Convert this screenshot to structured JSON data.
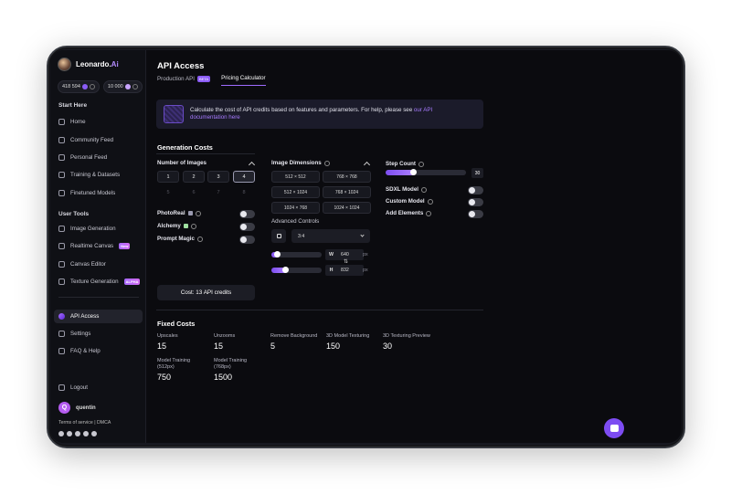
{
  "brand": {
    "name": "Leonardo.",
    "name_suffix": "Ai"
  },
  "credits": {
    "tokens": "418 594",
    "fast": "10 000"
  },
  "sidebar": {
    "start_title": "Start Here",
    "start_items": [
      {
        "label": "Home",
        "icon": "home-icon"
      },
      {
        "label": "Community Feed",
        "icon": "community-icon"
      },
      {
        "label": "Personal Feed",
        "icon": "grid-icon"
      },
      {
        "label": "Training & Datasets",
        "icon": "training-icon"
      },
      {
        "label": "Finetuned Models",
        "icon": "cube-icon"
      }
    ],
    "tools_title": "User Tools",
    "tool_items": [
      {
        "label": "Image Generation",
        "icon": "image-icon",
        "badge": ""
      },
      {
        "label": "Realtime Canvas",
        "icon": "brush-icon",
        "badge": "New"
      },
      {
        "label": "Canvas Editor",
        "icon": "canvas-icon",
        "badge": ""
      },
      {
        "label": "Texture Generation",
        "icon": "texture-icon",
        "badge": "ALPHA"
      }
    ],
    "bottom_items": [
      {
        "label": "API Access",
        "icon": "api-icon",
        "active": true
      },
      {
        "label": "Settings",
        "icon": "gear-icon",
        "active": false
      },
      {
        "label": "FAQ & Help",
        "icon": "help-icon",
        "active": false
      }
    ],
    "logout": "Logout",
    "user_initial": "Q",
    "user_name": "quentin",
    "terms": "Terms of service",
    "dmca": "DMCA",
    "sep": " | "
  },
  "page": {
    "title": "API Access",
    "tabs": [
      {
        "label": "Production API",
        "badge": "BETA"
      },
      {
        "label": "Pricing Calculator",
        "badge": ""
      }
    ],
    "banner_text": "Calculate the cost of API credits based on features and parameters. For help, please see ",
    "banner_link": "our API documentation here"
  },
  "generation": {
    "title": "Generation Costs",
    "num_images_label": "Number of Images",
    "num_images": [
      "1",
      "2",
      "3",
      "4",
      "5",
      "6",
      "7",
      "8"
    ],
    "num_images_selected": "4",
    "photoreal": "PhotoReal",
    "alchemy": "Alchemy",
    "prompt_magic": "Prompt Magic",
    "cost": "Cost: 13 API credits",
    "dimensions_label": "Image Dimensions",
    "dimensions": [
      "512 × 512",
      "768 × 768",
      "512 × 1024",
      "768 × 1024",
      "1024 × 768",
      "1024 × 1024"
    ],
    "advanced_label": "Advanced Controls",
    "aspect": "3:4",
    "width_key": "W",
    "width": "640",
    "height_key": "H",
    "height": "832",
    "unit": "px",
    "swap_glyph": "⇅",
    "step_label": "Step Count",
    "step_value": "30",
    "step_fraction": 0.34,
    "width_fraction": 0.1,
    "height_fraction": 0.28,
    "sdxl": "SDXL Model",
    "custom": "Custom Model",
    "elements": "Add Elements"
  },
  "fixed": {
    "title": "Fixed Costs",
    "items": [
      {
        "label": "Upscales",
        "value": "15"
      },
      {
        "label": "Unzooms",
        "value": "15"
      },
      {
        "label": "Remove Background",
        "value": "5"
      },
      {
        "label": "3D Model Texturing",
        "value": "150"
      },
      {
        "label": "3D Texturing Preview",
        "value": "30"
      },
      {
        "label": "Model Training (512px)",
        "value": "750"
      },
      {
        "label": "Model Training (768px)",
        "value": "1500"
      }
    ]
  }
}
